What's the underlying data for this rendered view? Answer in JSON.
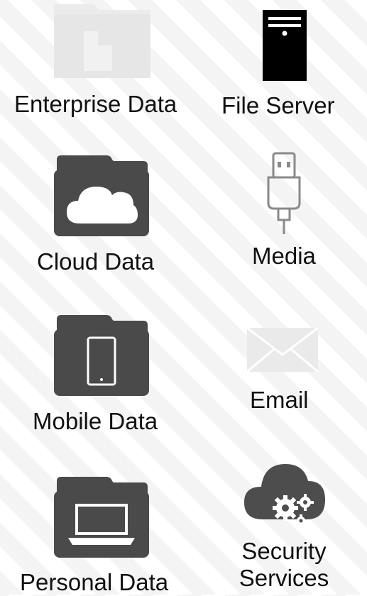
{
  "colors": {
    "folder": "#4a4a4a",
    "folder_faded": "#e9e9e9",
    "server": "#000000",
    "usb": "#8a8a8a",
    "envelope": "#e6e6e6",
    "cloud": "#4d4d4d",
    "white": "#ffffff"
  },
  "items": [
    {
      "label": "Enterprise Data",
      "icon": "enterprise-folder-icon"
    },
    {
      "label": "File Server",
      "icon": "server-icon"
    },
    {
      "label": "Cloud Data",
      "icon": "cloud-folder-icon"
    },
    {
      "label": "Media",
      "icon": "usb-icon"
    },
    {
      "label": "Mobile Data",
      "icon": "mobile-folder-icon"
    },
    {
      "label": "Email",
      "icon": "envelope-icon"
    },
    {
      "label": "Personal Data",
      "icon": "laptop-folder-icon"
    },
    {
      "label": "Security",
      "icon": "cloud-gears-icon"
    },
    {
      "label": "Services",
      "icon": "cloud-gears-icon"
    }
  ]
}
